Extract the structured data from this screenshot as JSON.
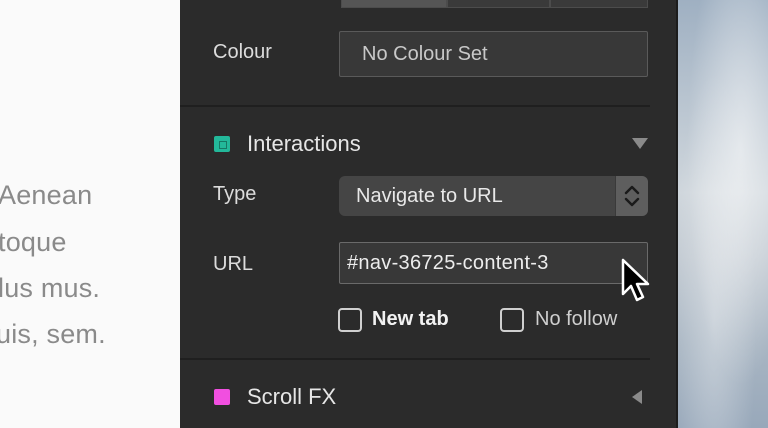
{
  "document": {
    "lines": [
      "Aenean",
      "toque",
      "lus mus.",
      "uis, sem."
    ]
  },
  "panel": {
    "colour": {
      "label": "Colour",
      "value": "No Colour Set"
    },
    "interactions": {
      "title": "Interactions",
      "icon_color": "#23b89a",
      "type_label": "Type",
      "type_value": "Navigate to URL",
      "url_label": "URL",
      "url_value": "#nav-36725-content-3",
      "new_tab_label": "New tab",
      "new_tab_checked": false,
      "no_follow_label": "No follow",
      "no_follow_checked": false
    },
    "scroll_fx": {
      "title": "Scroll FX",
      "icon_color": "#f14fe0"
    }
  }
}
